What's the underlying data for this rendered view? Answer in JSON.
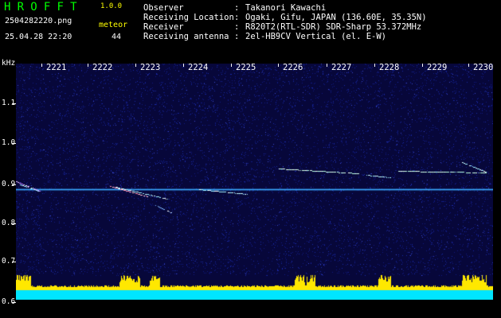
{
  "app": {
    "name": "HROFFT",
    "version": "1.0.0"
  },
  "file": {
    "name": "2504282220.png",
    "datetime": "25.04.28 22:20"
  },
  "meteor": {
    "label": "meteor",
    "count": "44"
  },
  "info": [
    {
      "key": "Observer",
      "sep": ":",
      "value": "Takanori Kawachi"
    },
    {
      "key": "Receiving Location",
      "sep": ":",
      "value": "Ogaki, Gifu, JAPAN (136.60E, 35.35N)"
    },
    {
      "key": "Receiver",
      "sep": ":",
      "value": "R820T2(RTL-SDR) SDR-Sharp 53.372MHz"
    },
    {
      "key": "Receiving antenna",
      "sep": ":",
      "value": "2el-HB9CV Vertical (el. E-W)"
    }
  ],
  "axis": {
    "y_unit": "kHz",
    "x_ticks": [
      "2221",
      "2222",
      "2223",
      "2224",
      "2225",
      "2226",
      "2227",
      "2228",
      "2229",
      "2230"
    ],
    "y_ticks": [
      "1.1",
      "1.0",
      "0.9",
      "0.8",
      "0.7",
      "0.6"
    ]
  },
  "colors": {
    "background": "#0a0a3a",
    "noise_blue": "#1a2aa0",
    "carrier": "#33aaff",
    "echo": "#a6ffd4",
    "audio_bars": "#ffff00",
    "baseline": "#00e5ff"
  }
}
